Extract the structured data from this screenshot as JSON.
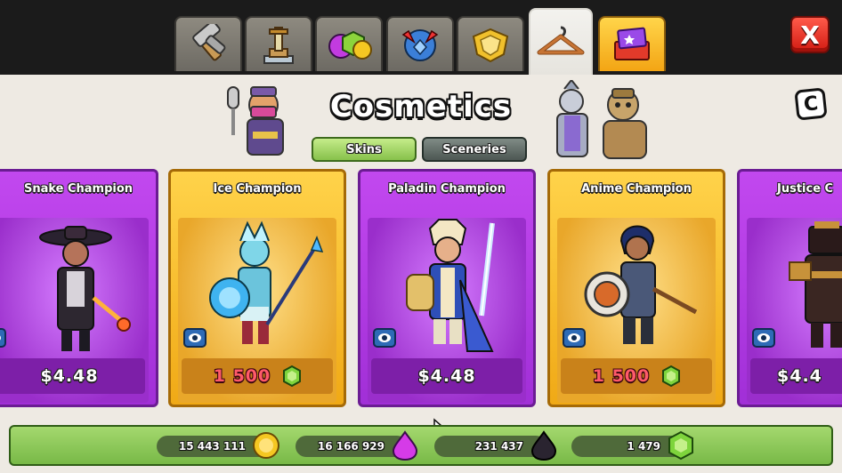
{
  "tabs": [
    {
      "name": "builder-tools",
      "icon": "hammer-icon"
    },
    {
      "name": "training-statue",
      "icon": "statue-icon"
    },
    {
      "name": "resources",
      "icon": "resources-icon"
    },
    {
      "name": "league-badge",
      "icon": "league-badge-icon"
    },
    {
      "name": "war-badge",
      "icon": "war-badge-icon"
    },
    {
      "name": "cosmetics",
      "icon": "hanger-icon",
      "active": true
    },
    {
      "name": "book-offers",
      "icon": "book-icon"
    }
  ],
  "close_label": "X",
  "title": "Cosmetics",
  "info_label": "C",
  "subtabs": {
    "skins": "Skins",
    "sceneries": "Sceneries"
  },
  "cards": [
    {
      "name": "Snake Champion",
      "price": "$4.48",
      "style": "purple",
      "currency": "money"
    },
    {
      "name": "Ice Champion",
      "price": "1 500",
      "style": "gold",
      "currency": "gem"
    },
    {
      "name": "Paladin Champion",
      "price": "$4.48",
      "style": "purple",
      "currency": "money"
    },
    {
      "name": "Anime Champion",
      "price": "1 500",
      "style": "gold",
      "currency": "gem"
    },
    {
      "name": "Justice C",
      "price": "$4.4",
      "style": "purple",
      "currency": "money"
    }
  ],
  "resources": {
    "gold": "15 443 111",
    "elixir": "16 166 929",
    "dark_elixir": "231 437",
    "gems": "1 479"
  },
  "colors": {
    "purple_card": "#b13de2",
    "gold_card": "#f7bd2c",
    "gem_price_text": "#ff5a6a",
    "resource_bar": "#8fca5a"
  }
}
